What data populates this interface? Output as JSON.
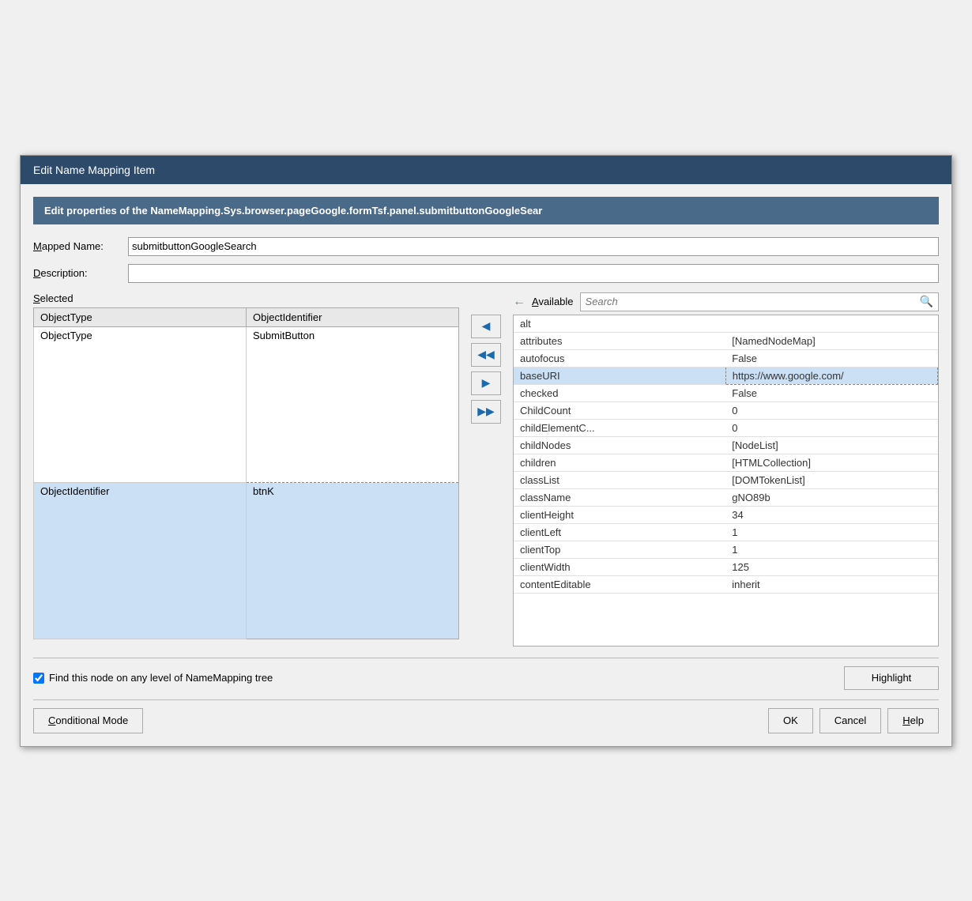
{
  "dialog": {
    "title": "Edit Name Mapping Item",
    "banner": "Edit properties of the NameMapping.Sys.browser.pageGoogle.formTsf.panel.submitbuttonGoogleSear",
    "mapped_name_label": "Mapped Name:",
    "mapped_name_value": "submitbuttonGoogleSearch",
    "description_label": "Description:",
    "description_value": "",
    "selected_label": "Selected",
    "available_label": "Available",
    "search_placeholder": "Search"
  },
  "selected_table": {
    "col1_header": "ObjectType",
    "col2_header": "ObjectIdentifier",
    "rows": [
      {
        "col1": "ObjectType",
        "col2": "SubmitButton",
        "selected": false
      },
      {
        "col1": "ObjectIdentifier",
        "col2": "btnK",
        "selected": true
      }
    ]
  },
  "available_table": {
    "rows": [
      {
        "property": "alt",
        "value": ""
      },
      {
        "property": "attributes",
        "value": "[NamedNodeMap]"
      },
      {
        "property": "autofocus",
        "value": "False"
      },
      {
        "property": "baseURI",
        "value": "https://www.google.com/",
        "highlighted": true
      },
      {
        "property": "checked",
        "value": "False"
      },
      {
        "property": "ChildCount",
        "value": "0"
      },
      {
        "property": "childElementC...",
        "value": "0"
      },
      {
        "property": "childNodes",
        "value": "[NodeList]"
      },
      {
        "property": "children",
        "value": "[HTMLCollection]"
      },
      {
        "property": "classList",
        "value": "[DOMTokenList]"
      },
      {
        "property": "className",
        "value": "gNO89b"
      },
      {
        "property": "clientHeight",
        "value": "34"
      },
      {
        "property": "clientLeft",
        "value": "1"
      },
      {
        "property": "clientTop",
        "value": "1"
      },
      {
        "property": "clientWidth",
        "value": "125"
      },
      {
        "property": "contentEditable",
        "value": "inherit"
      }
    ]
  },
  "buttons": {
    "move_left": "◄",
    "move_left_all": "◄◄",
    "move_right": "►",
    "move_right_all": "►►",
    "find_node_label": "Find this node on any level of NameMapping tree",
    "find_node_checked": true,
    "highlight": "Highlight",
    "conditional_mode": "Conditional Mode",
    "ok": "OK",
    "cancel": "Cancel",
    "help": "Help"
  }
}
